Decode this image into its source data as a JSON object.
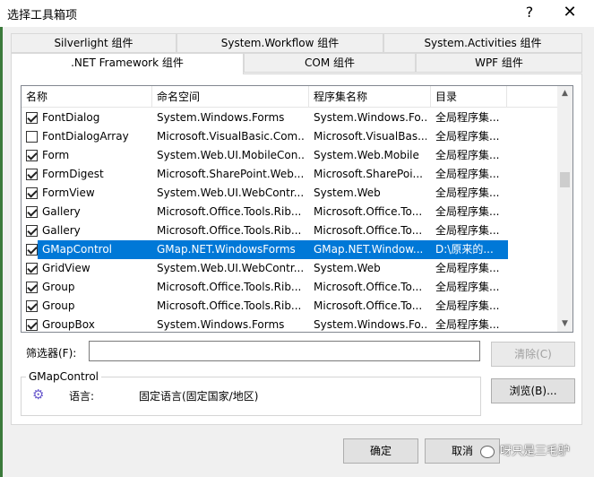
{
  "window": {
    "title": "选择工具箱项",
    "help_glyph": "?",
    "close_glyph": "✕"
  },
  "tabs": {
    "row1": [
      "Silverlight 组件",
      "System.Workflow 组件",
      "System.Activities 组件"
    ],
    "row2": [
      ".NET Framework 组件",
      "COM 组件",
      "WPF 组件"
    ],
    "active": ".NET Framework 组件"
  },
  "list": {
    "columns": [
      "名称",
      "命名空间",
      "程序集名称",
      "目录"
    ],
    "rows": [
      {
        "checked": true,
        "name": "FontDialog",
        "namespace": "System.Windows.Forms",
        "assembly": "System.Windows.Fo...",
        "directory": "全局程序集..."
      },
      {
        "checked": false,
        "name": "FontDialogArray",
        "namespace": "Microsoft.VisualBasic.Com...",
        "assembly": "Microsoft.VisualBas...",
        "directory": "全局程序集..."
      },
      {
        "checked": true,
        "name": "Form",
        "namespace": "System.Web.UI.MobileCon...",
        "assembly": "System.Web.Mobile",
        "directory": "全局程序集..."
      },
      {
        "checked": true,
        "name": "FormDigest",
        "namespace": "Microsoft.SharePoint.Web...",
        "assembly": "Microsoft.SharePoi...",
        "directory": "全局程序集..."
      },
      {
        "checked": true,
        "name": "FormView",
        "namespace": "System.Web.UI.WebContr...",
        "assembly": "System.Web",
        "directory": "全局程序集..."
      },
      {
        "checked": true,
        "name": "Gallery",
        "namespace": "Microsoft.Office.Tools.Rib...",
        "assembly": "Microsoft.Office.To...",
        "directory": "全局程序集..."
      },
      {
        "checked": true,
        "name": "Gallery",
        "namespace": "Microsoft.Office.Tools.Rib...",
        "assembly": "Microsoft.Office.To...",
        "directory": "全局程序集..."
      },
      {
        "checked": true,
        "name": "GMapControl",
        "namespace": "GMap.NET.WindowsForms",
        "assembly": "GMap.NET.Window...",
        "directory": "D:\\原来的...",
        "selected": true
      },
      {
        "checked": true,
        "name": "GridView",
        "namespace": "System.Web.UI.WebContr...",
        "assembly": "System.Web",
        "directory": "全局程序集..."
      },
      {
        "checked": true,
        "name": "Group",
        "namespace": "Microsoft.Office.Tools.Rib...",
        "assembly": "Microsoft.Office.To...",
        "directory": "全局程序集..."
      },
      {
        "checked": true,
        "name": "Group",
        "namespace": "Microsoft.Office.Tools.Rib...",
        "assembly": "Microsoft.Office.To...",
        "directory": "全局程序集..."
      },
      {
        "checked": true,
        "name": "GroupBox",
        "namespace": "System.Windows.Forms",
        "assembly": "System.Windows.Fo...",
        "directory": "全局程序集..."
      }
    ]
  },
  "filter": {
    "label": "筛选器(F):",
    "value": "",
    "clear_label": "清除(C)"
  },
  "details": {
    "group_title": "GMapControl",
    "language_label": "语言:",
    "language_value": "固定语言(固定国家/地区)",
    "browse_label": "浏览(B)..."
  },
  "footer": {
    "ok_label": "确定",
    "cancel_label": "取消"
  },
  "watermark": "呀只是三毛驴",
  "colors": {
    "selection": "#0078d7",
    "accent_edge": "#3b7a3b"
  }
}
